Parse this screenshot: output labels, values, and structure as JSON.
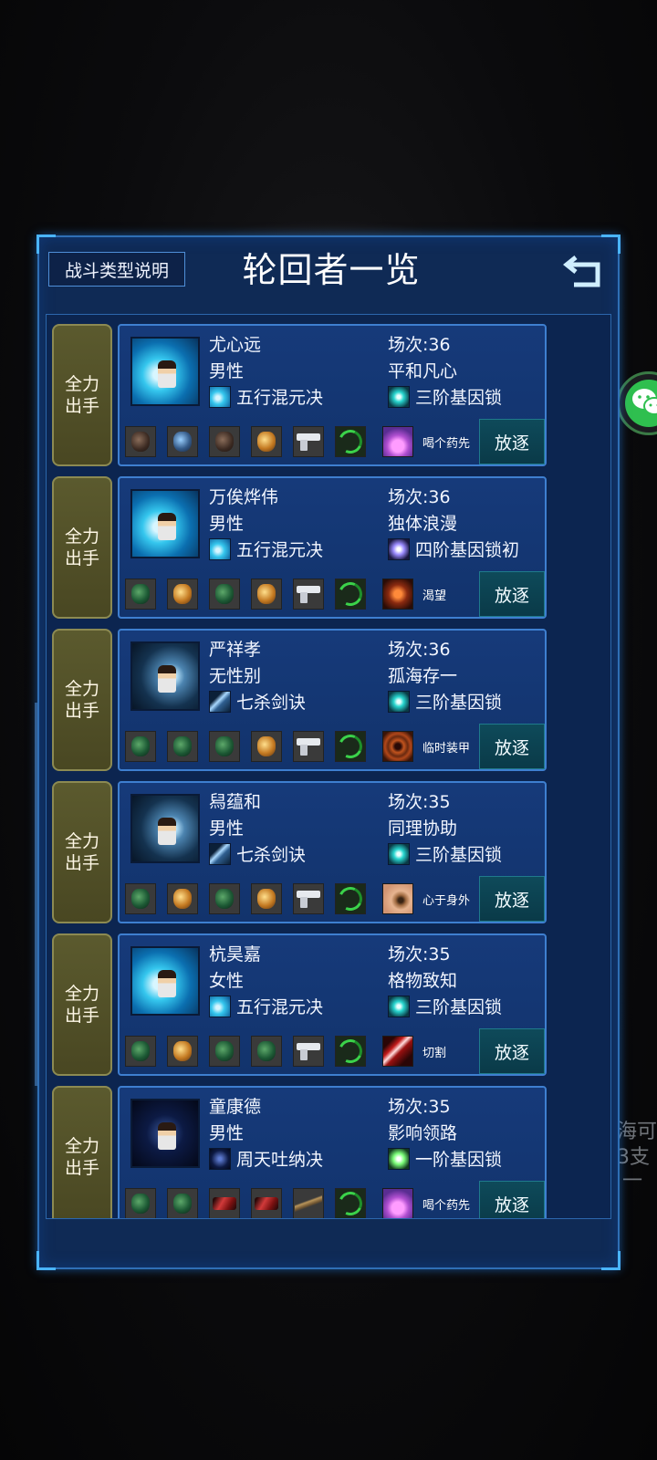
{
  "header": {
    "battle_help_label": "战斗类型说明",
    "title": "轮回者一览"
  },
  "background_scraps": [
    "海可",
    "3支",
    "一"
  ],
  "colors": {
    "panel_bg": "#0f2a55",
    "panel_border": "#2f6fb5",
    "mode_button": "#5b5a2e",
    "exile_button": "#0e4a5a",
    "wechat_green": "#2fbf4f"
  },
  "rows": [
    {
      "mode_label_1": "全力",
      "mode_label_2": "出手",
      "portrait": "swirl-portrait",
      "name": "尤心远",
      "gender": "男性",
      "skill_icon": "swirl-skill-icon",
      "skill": "五行混元决",
      "match": "场次:36",
      "trait": "平和凡心",
      "gene_icon": "cyan-gene-icon",
      "gene": "三阶基因锁",
      "equipment": [
        "dark-gem",
        "blue-gem",
        "dark-gem",
        "gold-gem",
        "gun",
        "armor"
      ],
      "ability_icon": "potion-icon",
      "ability": "喝个药先",
      "exile_label": "放逐"
    },
    {
      "mode_label_1": "全力",
      "mode_label_2": "出手",
      "portrait": "swirl-portrait",
      "name": "万俟烨伟",
      "gender": "男性",
      "skill_icon": "swirl-skill-icon",
      "skill": "五行混元决",
      "match": "场次:36",
      "trait": "独体浪漫",
      "gene_icon": "violet-gene-icon",
      "gene": "四阶基因锁初",
      "equipment": [
        "green-gem",
        "gold-gem",
        "green-gem",
        "gold-gem",
        "gun",
        "armor"
      ],
      "ability_icon": "claw-icon",
      "ability": "渴望",
      "exile_label": "放逐"
    },
    {
      "mode_label_1": "全力",
      "mode_label_2": "出手",
      "portrait": "blade-portrait",
      "name": "严祥孝",
      "gender": "无性别",
      "skill_icon": "blade-skill-icon",
      "skill": "七杀剑诀",
      "match": "场次:36",
      "trait": "孤海存一",
      "gene_icon": "cyan-gene-icon",
      "gene": "三阶基因锁",
      "equipment": [
        "green-gem",
        "green-gem",
        "green-gem",
        "gold-gem",
        "gun",
        "armor"
      ],
      "ability_icon": "shield-icon",
      "ability": "临时装甲",
      "exile_label": "放逐"
    },
    {
      "mode_label_1": "全力",
      "mode_label_2": "出手",
      "portrait": "blade-portrait",
      "name": "舄蕴和",
      "gender": "男性",
      "skill_icon": "blade-skill-icon",
      "skill": "七杀剑诀",
      "match": "场次:35",
      "trait": "同理协助",
      "gene_icon": "cyan-gene-icon",
      "gene": "三阶基因锁",
      "equipment": [
        "green-gem",
        "gold-gem",
        "green-gem",
        "gold-gem",
        "gun",
        "armor"
      ],
      "ability_icon": "eye-icon",
      "ability": "心于身外",
      "exile_label": "放逐"
    },
    {
      "mode_label_1": "全力",
      "mode_label_2": "出手",
      "portrait": "swirl-portrait",
      "name": "杭昊嘉",
      "gender": "女性",
      "skill_icon": "swirl-skill-icon",
      "skill": "五行混元决",
      "match": "场次:35",
      "trait": "格物致知",
      "gene_icon": "cyan-gene-icon",
      "gene": "三阶基因锁",
      "equipment": [
        "green-gem",
        "gold-gem",
        "green-gem",
        "green-gem",
        "gun",
        "armor"
      ],
      "ability_icon": "cut-icon",
      "ability": "切割",
      "exile_label": "放逐"
    },
    {
      "mode_label_1": "全力",
      "mode_label_2": "出手",
      "portrait": "star-portrait",
      "name": "童康德",
      "gender": "男性",
      "skill_icon": "star-skill-icon",
      "skill": "周天吐纳决",
      "match": "场次:35",
      "trait": "影响领路",
      "gene_icon": "green-gene-icon",
      "gene": "一阶基因锁",
      "equipment": [
        "green-gem",
        "green-gem",
        "red-gem",
        "red-gem",
        "stick",
        "armor"
      ],
      "ability_icon": "potion-icon",
      "ability": "喝个药先",
      "exile_label": "放逐"
    }
  ]
}
